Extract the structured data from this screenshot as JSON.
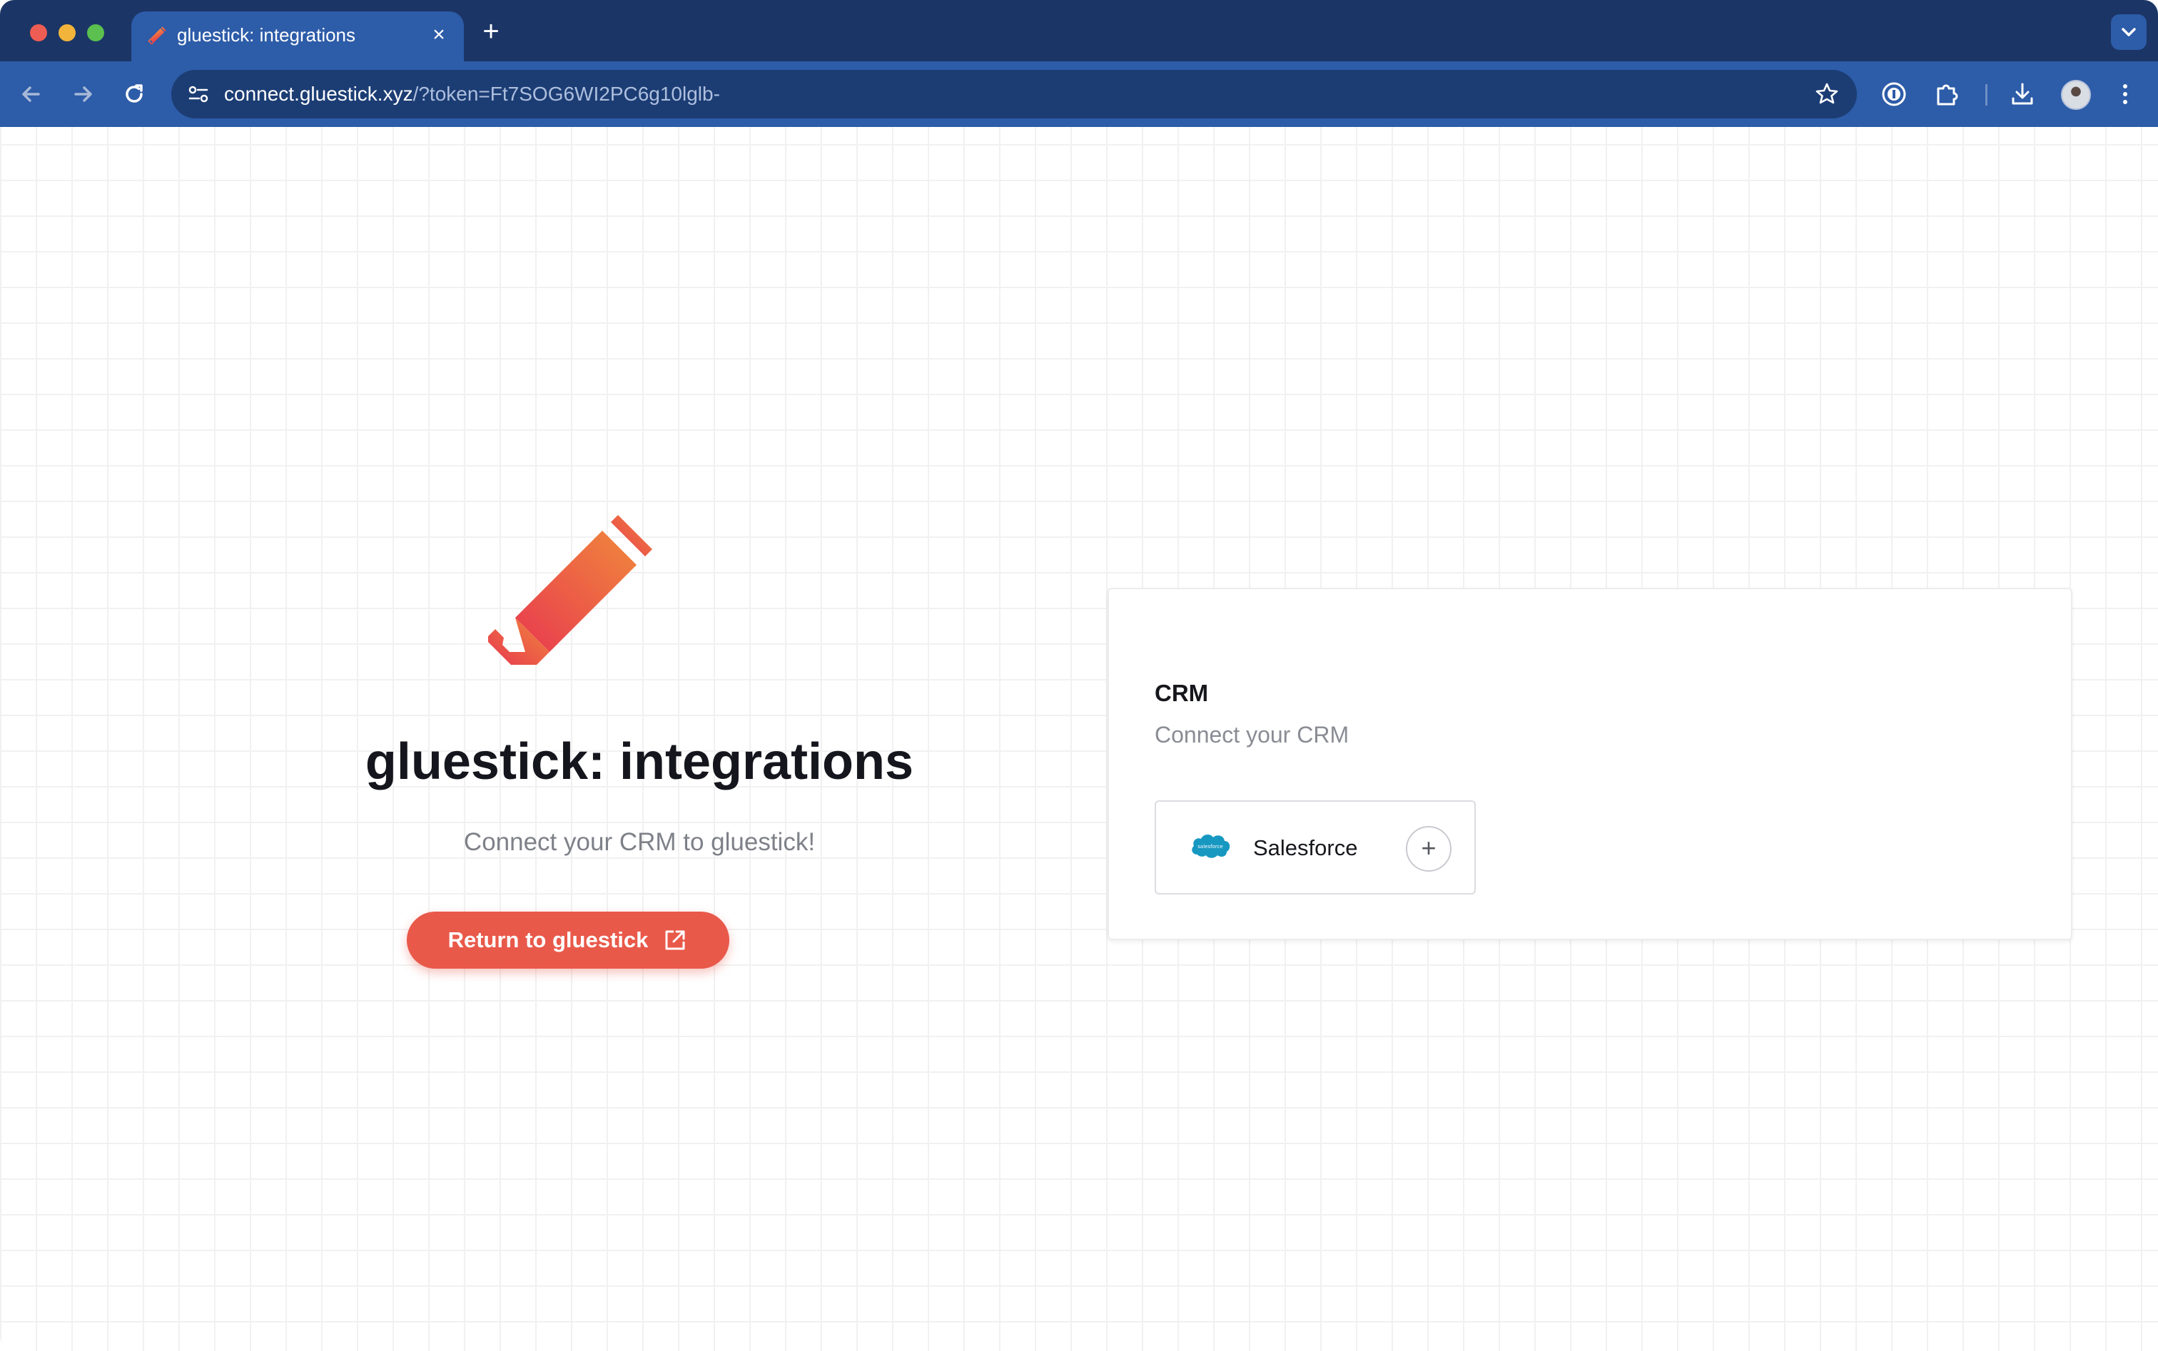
{
  "browser": {
    "tab": {
      "title": "gluestick: integrations",
      "favicon": "gluestick-logo-icon"
    },
    "address_bar": {
      "host": "connect.gluestick.xyz",
      "path": "/?token=Ft7SOG6WI2PC6g10lglb-"
    },
    "icons": [
      "back-arrow-icon",
      "forward-arrow-icon",
      "reload-icon",
      "site-info-icon",
      "bookmark-star-icon",
      "password-manager-icon",
      "extensions-icon",
      "download-icon",
      "profile-avatar",
      "more-menu-icon"
    ]
  },
  "hero": {
    "title": "gluestick: integrations",
    "subtitle": "Connect your CRM to gluestick!",
    "return_button_label": "Return to gluestick"
  },
  "crm_card": {
    "title": "CRM",
    "subtitle": "Connect your CRM",
    "integrations": [
      {
        "name": "Salesforce",
        "logo_text": "salesforce"
      }
    ]
  },
  "colors": {
    "accent": "#e9594a",
    "browser_frame": "#1b3566",
    "toolbar": "#2d5ca8",
    "logo_gradient_start": "#e8394f",
    "logo_gradient_end": "#f0883c",
    "salesforce_blue": "#1798c1"
  }
}
